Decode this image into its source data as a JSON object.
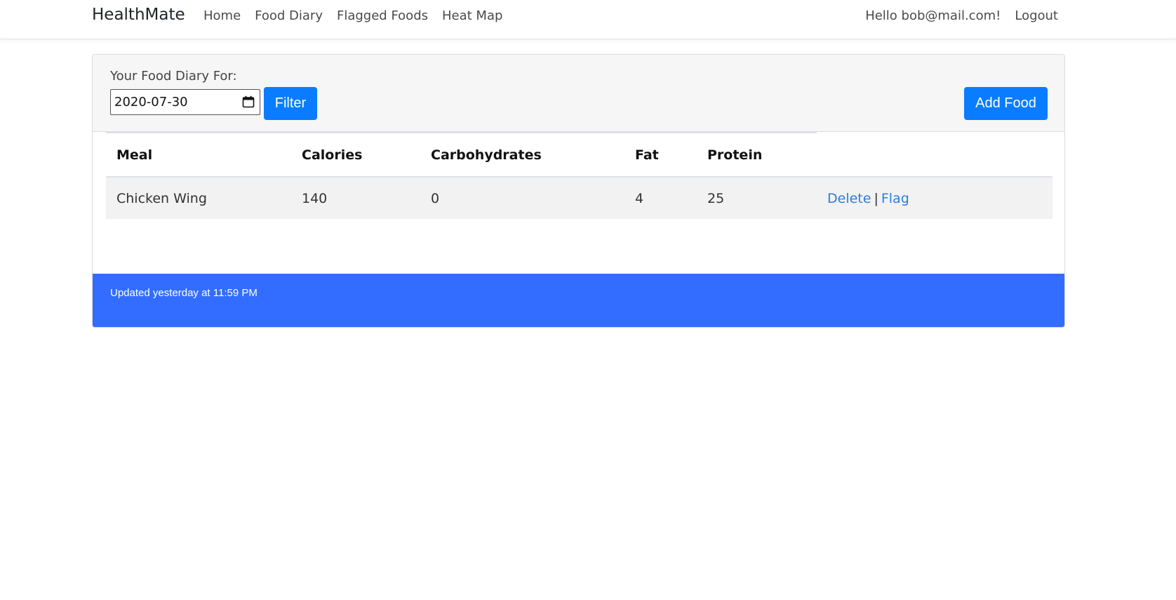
{
  "navbar": {
    "brand": "HealthMate",
    "links": [
      "Home",
      "Food Diary",
      "Flagged Foods",
      "Heat Map"
    ],
    "greeting": "Hello bob@mail.com!",
    "logout": "Logout"
  },
  "diary": {
    "label": "Your Food Diary For:",
    "date_value": "2020-07-30",
    "filter_label": "Filter",
    "add_label": "Add Food"
  },
  "table": {
    "headers": [
      "Meal",
      "Calories",
      "Carbohydrates",
      "Fat",
      "Protein"
    ],
    "rows": [
      {
        "meal": "Chicken Wing",
        "calories": "140",
        "carbohydrates": "0",
        "fat": "4",
        "protein": "25",
        "delete_label": "Delete",
        "separator": "|",
        "flag_label": "Flag"
      }
    ]
  },
  "footer": {
    "updated": "Updated yesterday at 11:59 PM"
  },
  "colors": {
    "primary_button": "#0a7cff",
    "footer_bg": "#336dff",
    "link": "#2a7de1"
  }
}
